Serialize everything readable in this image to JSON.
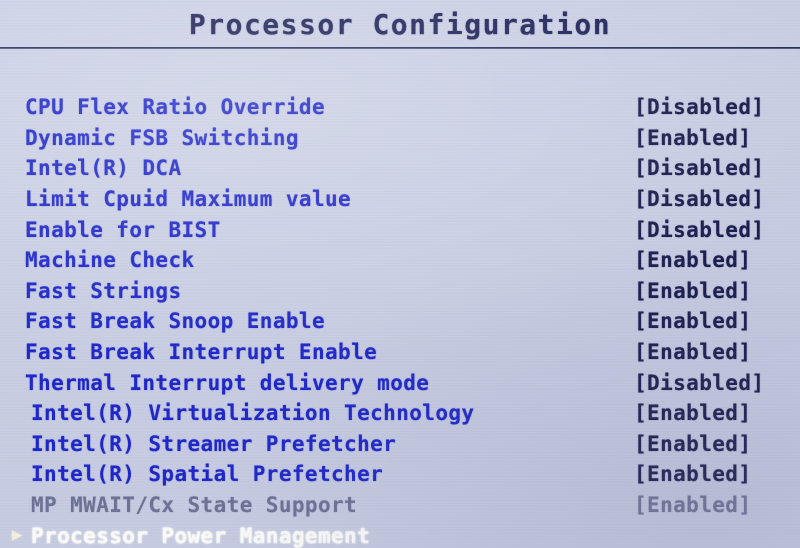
{
  "header": {
    "title": "Processor Configuration"
  },
  "colors": {
    "background": "#c9cee3",
    "label_text": "#1c24c8",
    "value_text": "#171a4b",
    "title_text": "#1b1f56",
    "disabled_text": "#6c7194",
    "selected_text": "#fbfbf6",
    "bullet": "#f4eedd",
    "rule": "#1a1e4e"
  },
  "menu": {
    "items": [
      {
        "label": "CPU Flex Ratio Override",
        "value": "[Disabled]",
        "indent": 0,
        "bullet": "",
        "state": "normal"
      },
      {
        "label": "Dynamic FSB Switching",
        "value": "[Enabled]",
        "indent": 0,
        "bullet": "",
        "state": "normal"
      },
      {
        "label": "Intel(R) DCA",
        "value": "[Disabled]",
        "indent": 0,
        "bullet": "",
        "state": "normal"
      },
      {
        "label": "Limit Cpuid Maximum value",
        "value": "[Disabled]",
        "indent": 0,
        "bullet": "",
        "state": "normal"
      },
      {
        "label": "Enable for BIST",
        "value": "[Disabled]",
        "indent": 0,
        "bullet": "",
        "state": "normal"
      },
      {
        "label": "Machine Check",
        "value": "[Enabled]",
        "indent": 0,
        "bullet": "",
        "state": "normal"
      },
      {
        "label": "Fast Strings",
        "value": "[Enabled]",
        "indent": 0,
        "bullet": "",
        "state": "normal"
      },
      {
        "label": "Fast Break Snoop Enable",
        "value": "[Enabled]",
        "indent": 0,
        "bullet": "",
        "state": "normal"
      },
      {
        "label": "Fast Break Interrupt Enable",
        "value": "[Enabled]",
        "indent": 0,
        "bullet": "",
        "state": "normal"
      },
      {
        "label": "Thermal Interrupt delivery mode",
        "value": "[Disabled]",
        "indent": 0,
        "bullet": "",
        "state": "normal"
      },
      {
        "label": "Intel(R) Virtualization Technology",
        "value": "[Enabled]",
        "indent": 1,
        "bullet": "",
        "state": "normal"
      },
      {
        "label": "Intel(R) Streamer Prefetcher",
        "value": "[Enabled]",
        "indent": 1,
        "bullet": "",
        "state": "normal"
      },
      {
        "label": "Intel(R) Spatial Prefetcher",
        "value": "[Enabled]",
        "indent": 1,
        "bullet": "",
        "state": "normal"
      },
      {
        "label": "MP MWAIT/Cx State Support",
        "value": "[Enabled]",
        "indent": 1,
        "bullet": "",
        "state": "disabled"
      },
      {
        "label": "Processor Power Management",
        "value": "",
        "indent": 1,
        "bullet": "▶",
        "state": "selected"
      }
    ]
  }
}
